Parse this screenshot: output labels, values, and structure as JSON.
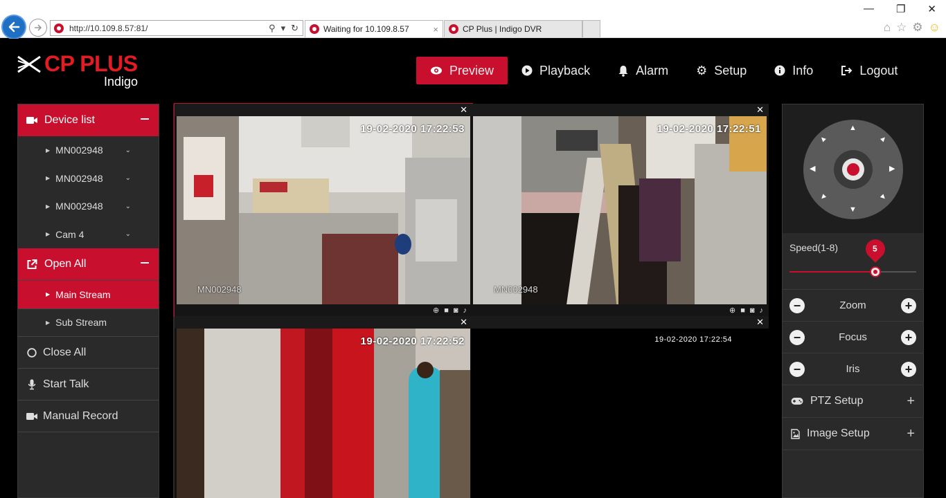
{
  "browser": {
    "url": "http://10.109.8.57:81/",
    "tabs": [
      {
        "title": "Waiting for 10.109.8.57",
        "close": "×"
      },
      {
        "title": "CP Plus | Indigo DVR"
      }
    ],
    "window_controls": [
      "—",
      "❐",
      "✕"
    ],
    "toolbar_icons": [
      "home-icon",
      "star-icon",
      "gear-icon",
      "smiley-icon"
    ]
  },
  "brand": {
    "name": "CP PLUS",
    "sub": "Indigo",
    "color": "#e31b23"
  },
  "nav": [
    {
      "label": "Preview",
      "icon": "eye-icon",
      "active": true
    },
    {
      "label": "Playback",
      "icon": "play-icon"
    },
    {
      "label": "Alarm",
      "icon": "bell-icon"
    },
    {
      "label": "Setup",
      "icon": "gear-icon"
    },
    {
      "label": "Info",
      "icon": "info-icon"
    },
    {
      "label": "Logout",
      "icon": "logout-icon"
    }
  ],
  "sidebar": {
    "device_header": "Device list",
    "devices": [
      "MN002948",
      "MN002948",
      "MN002948",
      "Cam 4"
    ],
    "open_header": "Open All",
    "streams": [
      {
        "label": "Main Stream",
        "selected": true
      },
      {
        "label": "Sub Stream",
        "selected": false
      }
    ],
    "actions": [
      {
        "label": "Close All",
        "icon": "circle-icon"
      },
      {
        "label": "Start Talk",
        "icon": "microphone-icon"
      },
      {
        "label": "Manual Record",
        "icon": "video-camera-icon"
      }
    ]
  },
  "panes": [
    {
      "timestamp": "19-02-2020 17:22:53",
      "camera": "MN002948",
      "selected": true
    },
    {
      "timestamp": "19-02-2020 17:22:51",
      "camera": "MN002948",
      "selected": false
    },
    {
      "timestamp": "19-02-2020 17:22:52",
      "camera": "",
      "selected": false
    },
    {
      "timestamp": "19-02-2020 17:22:54",
      "camera": "",
      "selected": false
    }
  ],
  "ptz": {
    "speed_label": "Speed(1-8)",
    "speed_value": "5",
    "speed_min": 1,
    "speed_max": 8,
    "controls": [
      "Zoom",
      "Focus",
      "Iris"
    ],
    "setups": [
      {
        "label": "PTZ Setup",
        "icon": "gamepad-icon"
      },
      {
        "label": "Image Setup",
        "icon": "image-icon"
      }
    ]
  },
  "colors": {
    "accent": "#c8102e",
    "background": "#000000",
    "panel": "#2a2a2a"
  }
}
